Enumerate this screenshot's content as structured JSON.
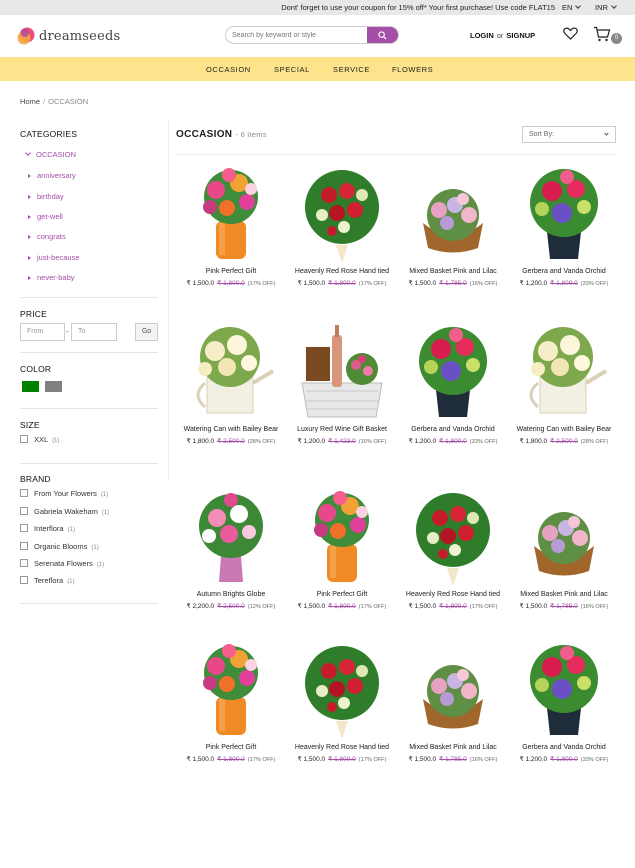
{
  "topbar": {
    "promo": "Dont' forget to use your coupon for 15% off* Your first purchase! Use code FLAT15",
    "language": "EN",
    "currency": "INR"
  },
  "header": {
    "brand": "dreamseeds",
    "search_placeholder": "Search by keyword or style",
    "login": "LOGIN",
    "or": "or",
    "signup": "SIGNUP",
    "cart_count": "0"
  },
  "nav": [
    "OCCASION",
    "SPECIAL",
    "SERVICE",
    "FLOWERS"
  ],
  "breadcrumb": {
    "home": "Home",
    "current": "OCCASION"
  },
  "sidebar": {
    "categories_title": "CATEGORIES",
    "category": "OCCASION",
    "subcategories": [
      "anniversary",
      "birthday",
      "get-well",
      "congrats",
      "just-because",
      "never-baby"
    ],
    "price_title": "PRICE",
    "price_from_placeholder": "From",
    "price_to_placeholder": "To",
    "price_go": "Go",
    "color_title": "COLOR",
    "colors": [
      "#008000",
      "#808080"
    ],
    "size_title": "SIZE",
    "sizes": [
      {
        "label": "XXL",
        "count": "(1)"
      }
    ],
    "brand_title": "BRAND",
    "brands": [
      {
        "label": "From Your Flowers",
        "count": "(1)"
      },
      {
        "label": "Gabriela Wakeham",
        "count": "(1)"
      },
      {
        "label": "Interflora",
        "count": "(1)"
      },
      {
        "label": "Organic Blooms",
        "count": "(1)"
      },
      {
        "label": "Serenata Flowers",
        "count": "(1)"
      },
      {
        "label": "Tereflora",
        "count": "(1)"
      }
    ]
  },
  "listing": {
    "title": "OCCASION",
    "count": "- 6 items",
    "sort_label": "Sort By:",
    "products": [
      {
        "name": "Pink Perfect Gift",
        "price": "₹ 1,500.0",
        "old": "₹ 1,800.0",
        "off": "(17% OFF)",
        "kind": "orange-vase"
      },
      {
        "name": "Heavenly Red Rose Hand tied",
        "price": "₹ 1,500.0",
        "old": "₹ 1,800.0",
        "off": "(17% OFF)",
        "kind": "red-rose"
      },
      {
        "name": "Mixed Basket Pink and Lilac",
        "price": "₹ 1,500.0",
        "old": "₹ 1,785.0",
        "off": "(16% OFF)",
        "kind": "basket"
      },
      {
        "name": "Gerbera and Vanda Orchid",
        "price": "₹ 1,200.0",
        "old": "₹ 1,800.0",
        "off": "(33% OFF)",
        "kind": "gerbera"
      },
      {
        "name": "Watering Can with Bailey Bear",
        "price": "₹ 1,800.0",
        "old": "₹ 2,500.0",
        "off": "(28% OFF)",
        "kind": "can"
      },
      {
        "name": "Luxury Red Wine Gift Basket",
        "price": "₹ 1,200.0",
        "old": "₹ 1,423.0",
        "off": "(16% OFF)",
        "kind": "wine"
      },
      {
        "name": "Gerbera and Vanda Orchid",
        "price": "₹ 1,200.0",
        "old": "₹ 1,800.0",
        "off": "(33% OFF)",
        "kind": "gerbera"
      },
      {
        "name": "Watering Can with Bailey Bear",
        "price": "₹ 1,800.0",
        "old": "₹ 2,500.0",
        "off": "(28% OFF)",
        "kind": "can"
      },
      {
        "name": "Autumn Brights Globe",
        "price": "₹ 2,200.0",
        "old": "₹ 2,500.0",
        "off": "(12% OFF)",
        "kind": "globe"
      },
      {
        "name": "Pink Perfect Gift",
        "price": "₹ 1,500.0",
        "old": "₹ 1,800.0",
        "off": "(17% OFF)",
        "kind": "orange-vase"
      },
      {
        "name": "Heavenly Red Rose Hand tied",
        "price": "₹ 1,500.0",
        "old": "₹ 1,800.0",
        "off": "(17% OFF)",
        "kind": "red-rose"
      },
      {
        "name": "Mixed Basket Pink and Lilac",
        "price": "₹ 1,500.0",
        "old": "₹ 1,785.0",
        "off": "(16% OFF)",
        "kind": "basket"
      },
      {
        "name": "Pink Perfect Gift",
        "price": "₹ 1,500.0",
        "old": "₹ 1,800.0",
        "off": "(17% OFF)",
        "kind": "orange-vase"
      },
      {
        "name": "Heavenly Red Rose Hand tied",
        "price": "₹ 1,500.0",
        "old": "₹ 1,800.0",
        "off": "(17% OFF)",
        "kind": "red-rose"
      },
      {
        "name": "Mixed Basket Pink and Lilac",
        "price": "₹ 1,500.0",
        "old": "₹ 1,785.0",
        "off": "(16% OFF)",
        "kind": "basket"
      },
      {
        "name": "Gerbera and Vanda Orchid",
        "price": "₹ 1,200.0",
        "old": "₹ 1,800.0",
        "off": "(33% OFF)",
        "kind": "gerbera"
      }
    ]
  },
  "theme": {
    "accent": "#a54ea7",
    "nav_bg": "#fde38c"
  }
}
